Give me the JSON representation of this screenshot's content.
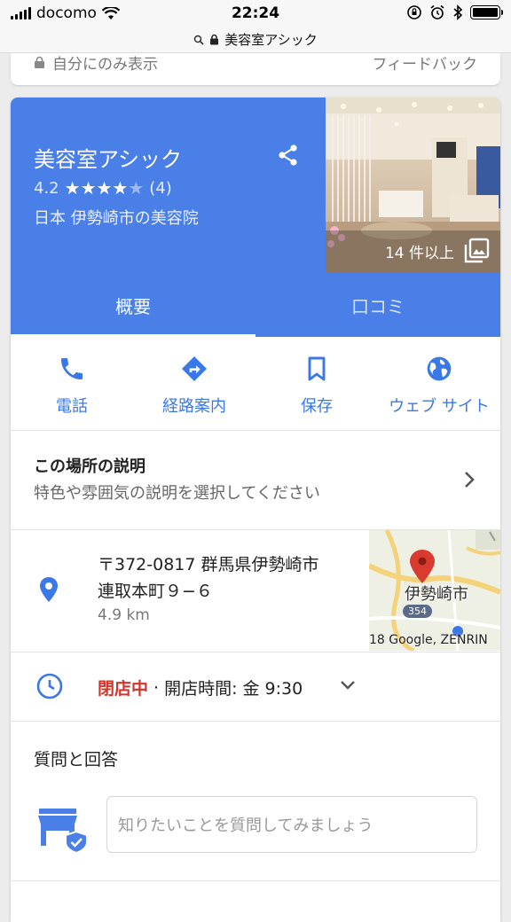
{
  "status_bar": {
    "carrier": "docomo",
    "time": "22:24"
  },
  "url_bar": {
    "text": "美容室アシック"
  },
  "previous_card": {
    "left_text": "自分にのみ表示",
    "right_text": "フィードバック"
  },
  "business": {
    "name": "美容室アシック",
    "rating": "4.2",
    "stars": "★★★★",
    "star_dim": "★",
    "review_count": "(4)",
    "category": "日本 伊勢崎市の美容院",
    "photo_count": "14 件以上"
  },
  "tabs": [
    {
      "label": "概要",
      "active": true
    },
    {
      "label": "口コミ",
      "active": false
    }
  ],
  "actions": [
    {
      "label": "電話",
      "icon": "phone-icon"
    },
    {
      "label": "経路案内",
      "icon": "directions-icon"
    },
    {
      "label": "保存",
      "icon": "bookmark-icon"
    },
    {
      "label": "ウェブ サイト",
      "icon": "globe-icon"
    }
  ],
  "description": {
    "title": "この場所の説明",
    "subtitle": "特色や雰囲気の説明を選択してください"
  },
  "address": {
    "line1": "〒372-0817 群馬県伊勢崎市",
    "line2": "連取本町９−６",
    "distance": "4.9 km",
    "map_label": "伊勢崎市",
    "map_route": "354",
    "map_attribution": "18 Google, ZENRIN"
  },
  "hours": {
    "status": "閉店中",
    "separator": "·",
    "next_open": "開店時間: 金 9:30"
  },
  "qa": {
    "title": "質問と回答",
    "placeholder": "知りたいことを質問してみましょう"
  },
  "colors": {
    "primary": "#4a7fe8",
    "action_blue": "#3b78e7",
    "closed_red": "#d1352b"
  }
}
